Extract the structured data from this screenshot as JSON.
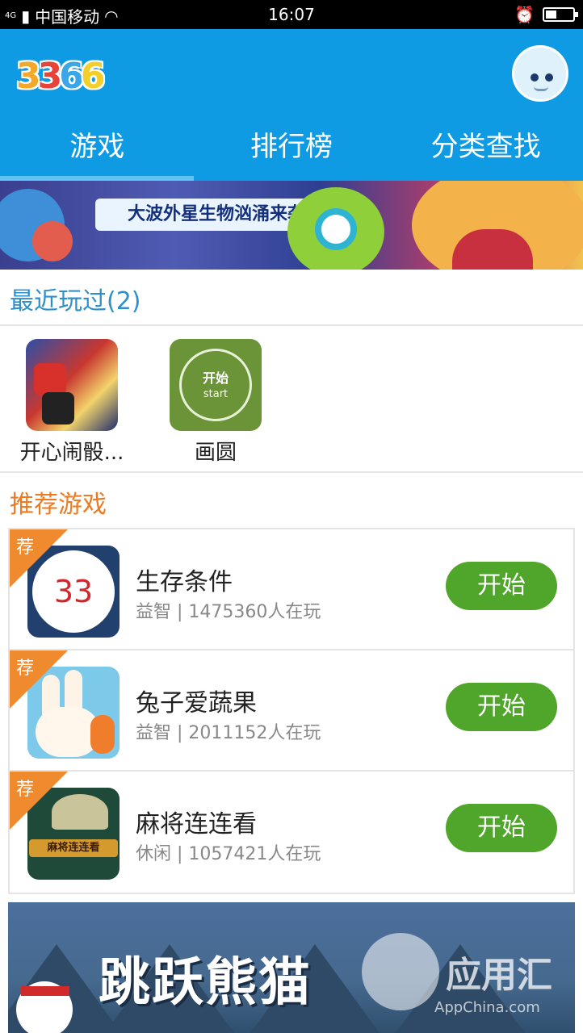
{
  "status_bar": {
    "network": "4G",
    "carrier": "中国移动",
    "time": "16:07",
    "battery_level": 0.4
  },
  "header": {
    "logo_text": "3366",
    "avatar_icon": "mascot-avatar",
    "brand_color": "#0f9be3"
  },
  "tabs": [
    {
      "label": "游戏",
      "active": true
    },
    {
      "label": "排行榜",
      "active": false
    },
    {
      "label": "分类查找",
      "active": false
    }
  ],
  "banner_top": {
    "text": "大波外星生物汹涌来袭"
  },
  "recent": {
    "title": "最近玩过(2)",
    "items": [
      {
        "label": "开心闹骰..."
      },
      {
        "label": "画圆",
        "icon_line1": "开始",
        "icon_line2": "start"
      }
    ]
  },
  "recommended": {
    "title": "推荐游戏",
    "badge": "荐",
    "start_label": "开始",
    "games": [
      {
        "name": "生存条件",
        "meta": "益智 | 1475360人在玩",
        "icon_text": "33"
      },
      {
        "name": "兔子爱蔬果",
        "meta": "益智 | 2011152人在玩"
      },
      {
        "name": "麻将连连看",
        "meta": "休闲 | 1057421人在玩",
        "icon_text": "麻将连连看"
      }
    ]
  },
  "banner_bottom": {
    "title": "跳跃熊猫",
    "watermark": "应用汇",
    "watermark_sub": "AppChina.com"
  },
  "colors": {
    "accent_blue": "#0f9be3",
    "section_blue": "#2f8fc9",
    "section_orange": "#ee7a1f",
    "start_green": "#4fa62a",
    "badge_orange": "#f08a2f"
  }
}
